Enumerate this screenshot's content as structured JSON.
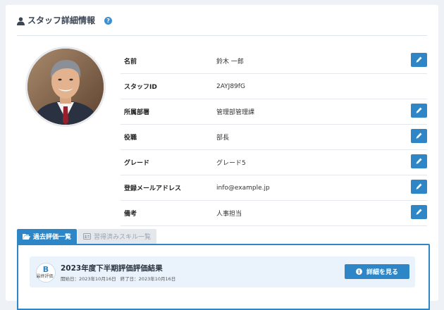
{
  "header": {
    "title": "スタッフ詳細情報",
    "icon": "user-icon",
    "help_icon": "?"
  },
  "profile": {
    "fields": [
      {
        "label": "名前",
        "value": "鈴木 一郎",
        "editable": true
      },
      {
        "label": "スタッフID",
        "value": "2AYJ89fG",
        "editable": false
      },
      {
        "label": "所属部署",
        "value": "管理部管理課",
        "editable": true
      },
      {
        "label": "役職",
        "value": "部長",
        "editable": true
      },
      {
        "label": "グレード",
        "value": "グレード5",
        "editable": true
      },
      {
        "label": "登録メールアドレス",
        "value": "info@example.jp",
        "editable": true
      },
      {
        "label": "備考",
        "value": "人事担当",
        "editable": true
      }
    ]
  },
  "tabs": [
    {
      "label": "過去評価一覧",
      "icon": "folder-open-icon",
      "active": true
    },
    {
      "label": "習得済みスキル一覧",
      "icon": "id-card-icon",
      "active": false
    }
  ],
  "evaluation": {
    "grade": "B",
    "grade_caption": "最終評価",
    "title": "2023年度下半期評価評価結果",
    "start_date": "開始日：2023年10月16日",
    "end_date": "終了日：2023年10月16日",
    "detail_button": "詳細を見る",
    "detail_icon": "i"
  },
  "colors": {
    "accent": "#2f86c7",
    "panel_bg": "#eaf3fb",
    "page_bg": "#eef1f5"
  }
}
